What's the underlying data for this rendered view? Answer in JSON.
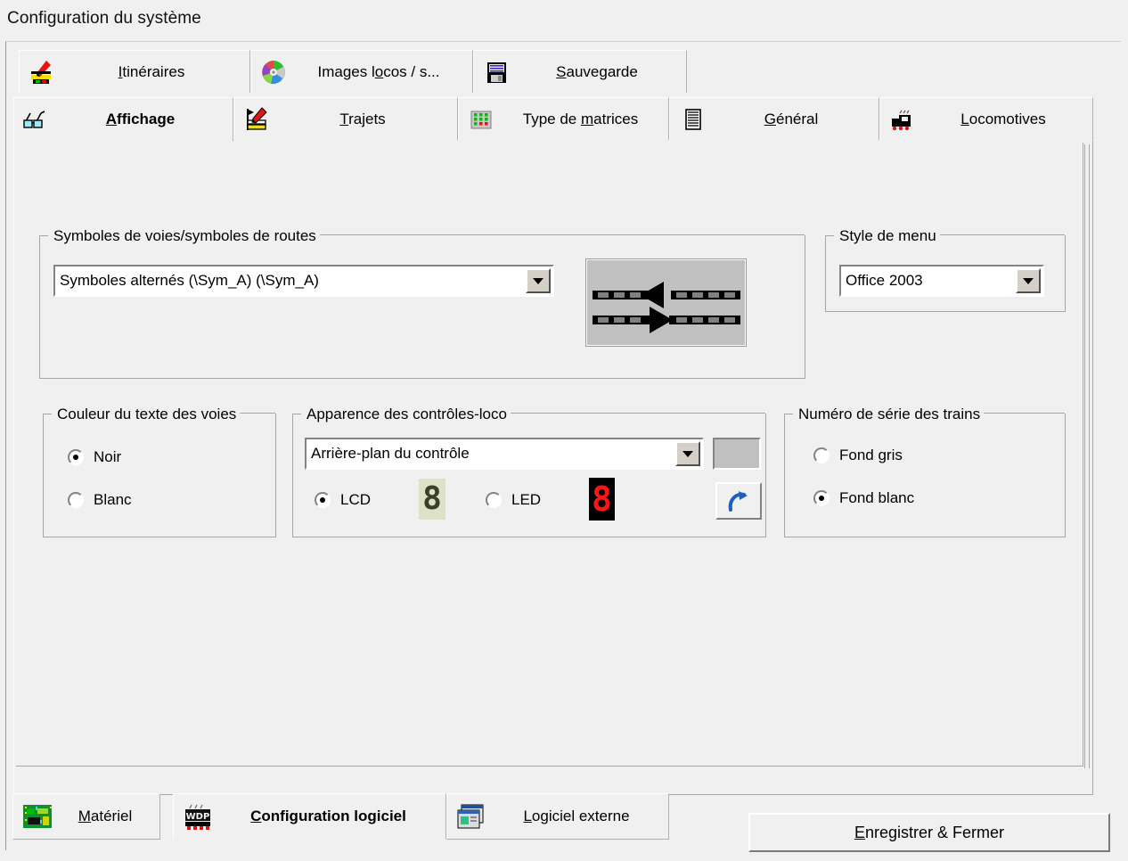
{
  "window": {
    "title": "Configuration du système"
  },
  "tabs_row1": [
    {
      "label": "Itinéraires",
      "icon": "route-marker-icon",
      "accesskey": "I",
      "selected": false
    },
    {
      "label": "Images locos / s...",
      "icon": "color-wheel-icon",
      "accesskey": "o",
      "selected": false
    },
    {
      "label": "Sauvegarde",
      "icon": "floppy-disk-icon",
      "accesskey": "S",
      "selected": false
    }
  ],
  "tabs_row2": [
    {
      "label": "Affichage",
      "icon": "glasses-icon",
      "accesskey": "A",
      "selected": true
    },
    {
      "label": "Trajets",
      "icon": "pencil-board-icon",
      "accesskey": "T",
      "selected": false
    },
    {
      "label": "Type de matrices",
      "icon": "matrix-dots-icon",
      "accesskey": "m",
      "selected": false
    },
    {
      "label": "Général",
      "icon": "document-lines-icon",
      "accesskey": "G",
      "selected": false
    },
    {
      "label": "Locomotives",
      "icon": "locomotive-icon",
      "accesskey": "L",
      "selected": false
    }
  ],
  "groups": {
    "track_symbols": {
      "title": "Symboles de voies/symboles de routes",
      "combo_value": "Symboles alternés (\\Sym_A)  (\\Sym_A)",
      "preview_name": "track-symbol-preview"
    },
    "menu_style": {
      "title": "Style de menu",
      "combo_value": "Office 2003"
    },
    "track_text_color": {
      "title": "Couleur du texte des voies",
      "options": [
        {
          "label": "Noir",
          "checked": true
        },
        {
          "label": "Blanc",
          "checked": false
        }
      ]
    },
    "loco_control_look": {
      "title": "Apparence des contrôles-loco",
      "combo_value": "Arrière-plan du contrôle",
      "swatch_color": "#c0c0c0",
      "display_options": [
        {
          "label": "LCD",
          "checked": true,
          "digit": "8",
          "fg": "#3b3f26",
          "bg": "#dfe0c8"
        },
        {
          "label": "LED",
          "checked": false,
          "digit": "8",
          "fg": "#ff1414",
          "bg": "#000000"
        }
      ],
      "reset_button": "reset-icon"
    },
    "train_serial": {
      "title": "Numéro de série des trains",
      "options": [
        {
          "label": "Fond gris",
          "checked": false
        },
        {
          "label": "Fond blanc",
          "checked": true
        }
      ]
    }
  },
  "bottom_tabs": [
    {
      "label": "Matériel",
      "icon": "circuit-board-icon",
      "accesskey": "M",
      "selected": false
    },
    {
      "label": "Configuration logiciel",
      "icon": "wdp-icon",
      "accesskey": "C",
      "selected": true
    },
    {
      "label": "Logiciel externe",
      "icon": "windows-stack-icon",
      "accesskey": "L",
      "selected": false
    }
  ],
  "footer": {
    "save_close_label": "Enregistrer & Fermer",
    "save_close_accesskey": "E"
  }
}
